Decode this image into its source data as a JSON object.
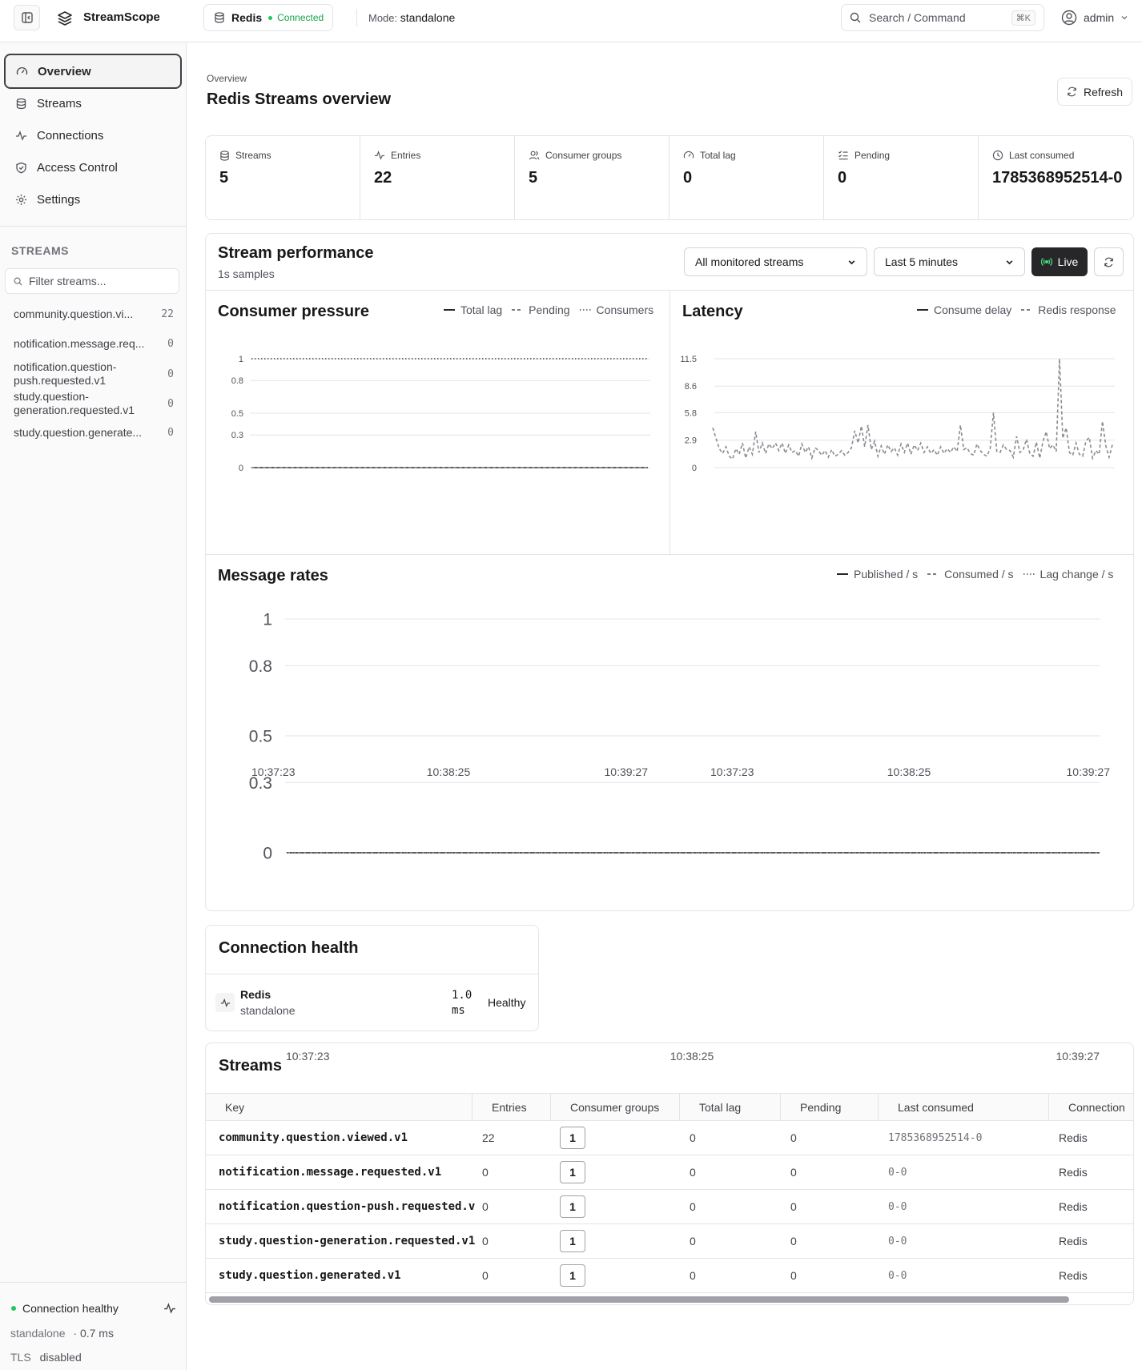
{
  "app": {
    "brand": "StreamScope",
    "connection_name": "Redis",
    "connection_status": "Connected",
    "mode_label": "Mode:",
    "mode_value": "standalone",
    "search_placeholder": "Search / Command",
    "search_kbd": "⌘K",
    "user": "admin"
  },
  "sidebar": {
    "nav": [
      {
        "label": "Overview",
        "icon": "gauge-icon",
        "active": true
      },
      {
        "label": "Streams",
        "icon": "database-icon"
      },
      {
        "label": "Connections",
        "icon": "activity-icon"
      },
      {
        "label": "Access Control",
        "icon": "shield-icon"
      },
      {
        "label": "Settings",
        "icon": "gear-icon"
      }
    ],
    "streams_heading": "STREAMS",
    "filter_placeholder": "Filter streams...",
    "streams": [
      {
        "name": "community.question.vi...",
        "count": "22"
      },
      {
        "name": "notification.message.req...",
        "count": "0"
      },
      {
        "name": "notification.question-push.requested.v1",
        "count": "0"
      },
      {
        "name": "study.question-generation.requested.v1",
        "count": "0"
      },
      {
        "name": "study.question.generate...",
        "count": "0"
      }
    ],
    "footer": {
      "health_label": "Connection healthy",
      "mode": "standalone",
      "latency": "· 0.7 ms",
      "tls_label": "TLS",
      "tls_value": "disabled"
    }
  },
  "main": {
    "breadcrumb": "Overview",
    "title": "Redis Streams overview",
    "refresh_label": "Refresh",
    "stats": [
      {
        "label": "Streams",
        "value": "5",
        "icon": "database-icon"
      },
      {
        "label": "Entries",
        "value": "22",
        "icon": "activity-icon"
      },
      {
        "label": "Consumer groups",
        "value": "5",
        "icon": "users-icon"
      },
      {
        "label": "Total lag",
        "value": "0",
        "icon": "gauge-icon"
      },
      {
        "label": "Pending",
        "value": "0",
        "icon": "list-checks-icon"
      },
      {
        "label": "Last consumed",
        "value": "1785368952514-0",
        "icon": "clock-icon"
      }
    ]
  },
  "performance": {
    "title": "Stream performance",
    "subtitle": "1s samples",
    "stream_select": "All monitored streams",
    "range_select": "Last 5 minutes",
    "live_label": "Live"
  },
  "chart_data": [
    {
      "type": "line",
      "title": "Consumer pressure",
      "x_ticks": [
        "10:37:23",
        "10:38:25",
        "10:39:27"
      ],
      "y_ticks": [
        "0",
        "0.3",
        "0.5",
        "0.8",
        "1"
      ],
      "ylim": [
        0,
        1
      ],
      "series": [
        {
          "name": "Total lag",
          "style": "solid",
          "values": [
            0,
            0,
            0,
            0,
            0
          ]
        },
        {
          "name": "Pending",
          "style": "dashed",
          "values": [
            0,
            0,
            0,
            0,
            0
          ]
        },
        {
          "name": "Consumers",
          "style": "dotted",
          "values": [
            1,
            1,
            1,
            1,
            1
          ]
        }
      ]
    },
    {
      "type": "line",
      "title": "Latency",
      "x_ticks": [
        "10:37:23",
        "10:38:25",
        "10:39:27"
      ],
      "y_ticks": [
        "0",
        "2.9",
        "5.8",
        "8.6",
        "11.5"
      ],
      "ylim": [
        0,
        11.5
      ],
      "series": [
        {
          "name": "Consume delay",
          "style": "solid",
          "values": []
        },
        {
          "name": "Redis response",
          "style": "dashed",
          "values": [
            4.2,
            3.1,
            2.0,
            1.5,
            2.2,
            1.2,
            0.9,
            2.0,
            1.4,
            2.6,
            1.0,
            2.2,
            1.4,
            3.8,
            1.6,
            2.6,
            1.5,
            2.5,
            2.0,
            2.6,
            1.8,
            2.6,
            1.5,
            2.4,
            1.6,
            1.8,
            1.2,
            2.5,
            1.6,
            2.2,
            1.0,
            2.1,
            1.8,
            1.3,
            1.8,
            1.1,
            1.9,
            1.2,
            1.4,
            1.8,
            1.3,
            1.6,
            2.1,
            3.9,
            2.6,
            4.4,
            2.2,
            4.5,
            1.9,
            2.8,
            1.2,
            2.3,
            1.4,
            2.4,
            1.7,
            2.1,
            1.3,
            2.5,
            1.6,
            2.6,
            1.4,
            2.4,
            1.8,
            2.6,
            1.6,
            2.2,
            1.5,
            1.9,
            1.3,
            2.2,
            1.5,
            2.0,
            1.6,
            2.2,
            1.7,
            4.5,
            1.9,
            2.1,
            1.5,
            1.3,
            2.5,
            1.8,
            1.4,
            1.2,
            2.0,
            5.8,
            1.7,
            1.6,
            2.4,
            1.9,
            1.8,
            1.1,
            3.3,
            1.6,
            1.9,
            3.0,
            1.5,
            1.2,
            2.7,
            1.0,
            2.8,
            3.8,
            2.0,
            2.4,
            1.7,
            11.5,
            3.1,
            4.2,
            1.6,
            1.3,
            2.6,
            1.4,
            1.2,
            2.8,
            3.2,
            1.0,
            1.8,
            1.4,
            4.9,
            2.3,
            1.1,
            2.4
          ]
        }
      ]
    },
    {
      "type": "line",
      "title": "Message rates",
      "x_ticks": [
        "10:37:23",
        "10:38:25",
        "10:39:27"
      ],
      "y_ticks": [
        "0",
        "0.3",
        "0.5",
        "0.8",
        "1"
      ],
      "ylim": [
        0,
        1
      ],
      "series": [
        {
          "name": "Published / s",
          "style": "solid",
          "values": [
            0,
            0,
            0,
            0,
            0
          ]
        },
        {
          "name": "Consumed / s",
          "style": "dashed",
          "values": [
            0,
            0,
            0,
            0,
            0
          ]
        },
        {
          "name": "Lag change / s",
          "style": "dotted",
          "values": [
            0,
            0,
            0,
            0,
            0
          ]
        }
      ]
    }
  ],
  "health": {
    "title": "Connection health",
    "name": "Redis",
    "mode": "standalone",
    "latency": "1.0 ms",
    "status": "Healthy"
  },
  "streams_table": {
    "title": "Streams",
    "columns": [
      "Key",
      "Entries",
      "Consumer groups",
      "Total lag",
      "Pending",
      "Last consumed",
      "Connection"
    ],
    "rows": [
      {
        "key": "community.question.viewed.v1",
        "entries": "22",
        "groups": "1",
        "lag": "0",
        "pending": "0",
        "last": "1785368952514-0",
        "conn": "Redis"
      },
      {
        "key": "notification.message.requested.v1",
        "entries": "0",
        "groups": "1",
        "lag": "0",
        "pending": "0",
        "last": "0-0",
        "conn": "Redis"
      },
      {
        "key": "notification.question-push.requested.v",
        "entries": "0",
        "groups": "1",
        "lag": "0",
        "pending": "0",
        "last": "0-0",
        "conn": "Redis"
      },
      {
        "key": "study.question-generation.requested.v1",
        "entries": "0",
        "groups": "1",
        "lag": "0",
        "pending": "0",
        "last": "0-0",
        "conn": "Redis"
      },
      {
        "key": "study.question.generated.v1",
        "entries": "0",
        "groups": "1",
        "lag": "0",
        "pending": "0",
        "last": "0-0",
        "conn": "Redis"
      }
    ]
  }
}
